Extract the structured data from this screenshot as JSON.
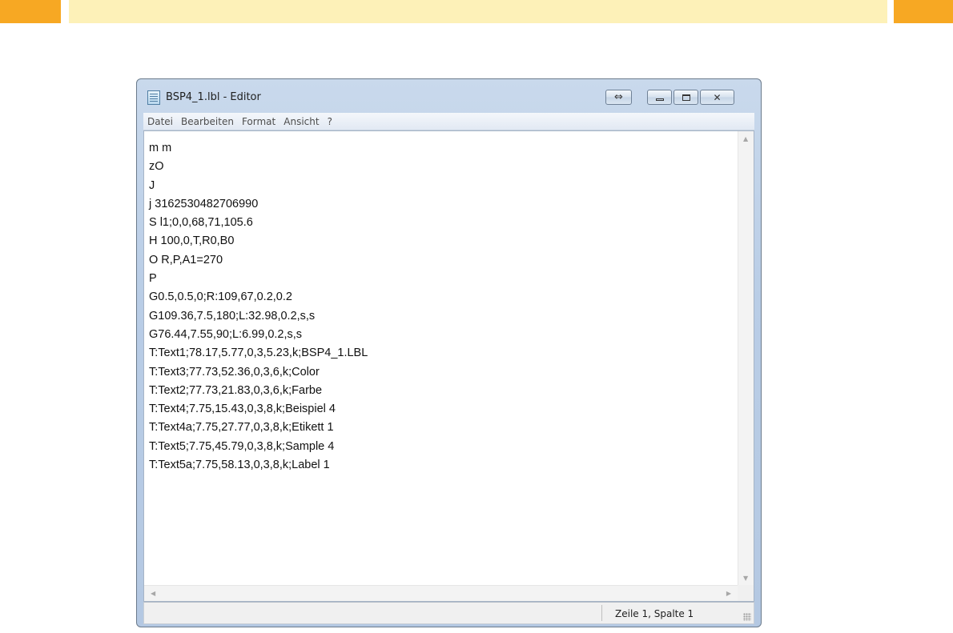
{
  "window": {
    "title": "BSP4_1.lbl - Editor",
    "icon": "notepad-icon"
  },
  "menu": {
    "items": [
      "Datei",
      "Bearbeiten",
      "Format",
      "Ansicht",
      "?"
    ]
  },
  "editor": {
    "lines": [
      "m m",
      "zO",
      "J",
      "j 3162530482706990",
      "S l1;0,0,68,71,105.6",
      "H 100,0,T,R0,B0",
      "O R,P,A1=270",
      "P",
      "G0.5,0.5,0;R:109,67,0.2,0.2",
      "G109.36,7.5,180;L:32.98,0.2,s,s",
      "G76.44,7.55,90;L:6.99,0.2,s,s",
      "T:Text1;78.17,5.77,0,3,5.23,k;BSP4_1.LBL",
      "T:Text3;77.73,52.36,0,3,6,k;Color",
      "T:Text2;77.73,21.83,0,3,6,k;Farbe",
      "T:Text4;7.75,15.43,0,3,8,k;Beispiel 4",
      "T:Text4a;7.75,27.77,0,3,8,k;Etikett 1",
      "T:Text5;7.75,45.79,0,3,8,k;Sample 4",
      "T:Text5a;7.75,58.13,0,3,8,k;Label 1"
    ]
  },
  "statusbar": {
    "position": "Zeile 1, Spalte 1"
  },
  "colors": {
    "accent_orange": "#f7a823",
    "banner_yellow": "#fdf1b8"
  }
}
